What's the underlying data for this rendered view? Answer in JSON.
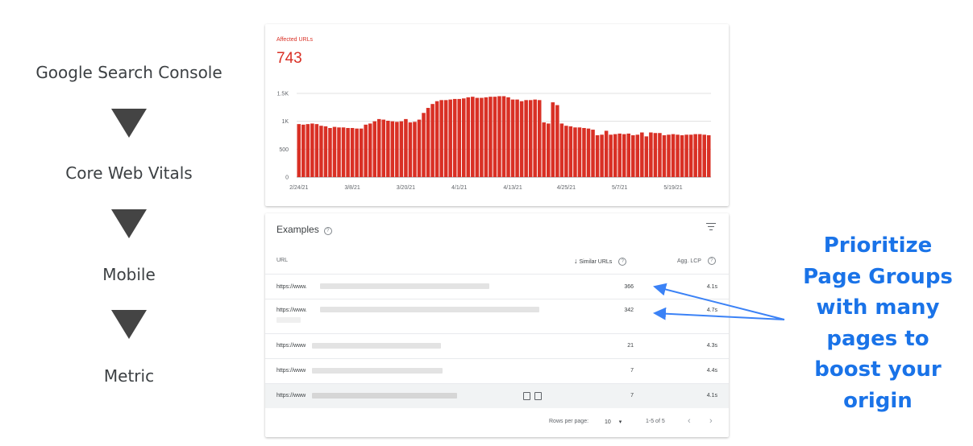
{
  "flow": {
    "steps": [
      "Google Search Console",
      "Core Web Vitals",
      "Mobile",
      "Metric"
    ]
  },
  "chart_card": {
    "label": "Affected URLs",
    "value": "743"
  },
  "chart_data": {
    "type": "bar",
    "x_ticks": [
      "2/24/21",
      "3/8/21",
      "3/20/21",
      "4/1/21",
      "4/13/21",
      "4/25/21",
      "5/7/21",
      "5/19/21"
    ],
    "y_ticks": [
      "0",
      "500",
      "1K",
      "1.5K"
    ],
    "ylim": [
      0,
      1500
    ],
    "grid": true,
    "color": "#d93025",
    "values": [
      950,
      940,
      950,
      960,
      950,
      920,
      910,
      880,
      900,
      890,
      890,
      880,
      880,
      870,
      870,
      940,
      960,
      1000,
      1040,
      1030,
      1010,
      1000,
      990,
      1000,
      1040,
      980,
      990,
      1030,
      1150,
      1240,
      1310,
      1360,
      1380,
      1380,
      1390,
      1400,
      1400,
      1410,
      1430,
      1440,
      1420,
      1420,
      1430,
      1440,
      1440,
      1450,
      1450,
      1430,
      1390,
      1390,
      1360,
      1380,
      1380,
      1390,
      1380,
      980,
      960,
      1340,
      1290,
      960,
      920,
      910,
      890,
      890,
      880,
      870,
      850,
      750,
      760,
      830,
      760,
      770,
      780,
      770,
      780,
      750,
      760,
      800,
      730,
      800,
      790,
      790,
      750,
      760,
      770,
      760,
      750,
      760,
      760,
      770,
      770,
      760,
      750
    ]
  },
  "examples": {
    "title": "Examples",
    "col_url": "URL",
    "col_similar": "Similar URLs",
    "col_lcp": "Agg. LCP",
    "rows": [
      {
        "url": "https://www.",
        "similar": "366",
        "lcp": "4.1s"
      },
      {
        "url": "https://www.",
        "similar": "342",
        "lcp": "4.7s"
      },
      {
        "url": "https://www",
        "similar": "21",
        "lcp": "4.3s"
      },
      {
        "url": "https://www",
        "similar": "7",
        "lcp": "4.4s"
      },
      {
        "url": "https://www",
        "similar": "7",
        "lcp": "4.1s"
      }
    ],
    "footer": {
      "rows_per_page_label": "Rows per page:",
      "rows_per_page_value": "10",
      "range": "1-5 of 5"
    }
  },
  "annotation": {
    "lines": [
      "Prioritize",
      "Page Groups",
      "with many",
      "pages to",
      "boost your",
      "origin"
    ],
    "color": "#1a73e8"
  }
}
